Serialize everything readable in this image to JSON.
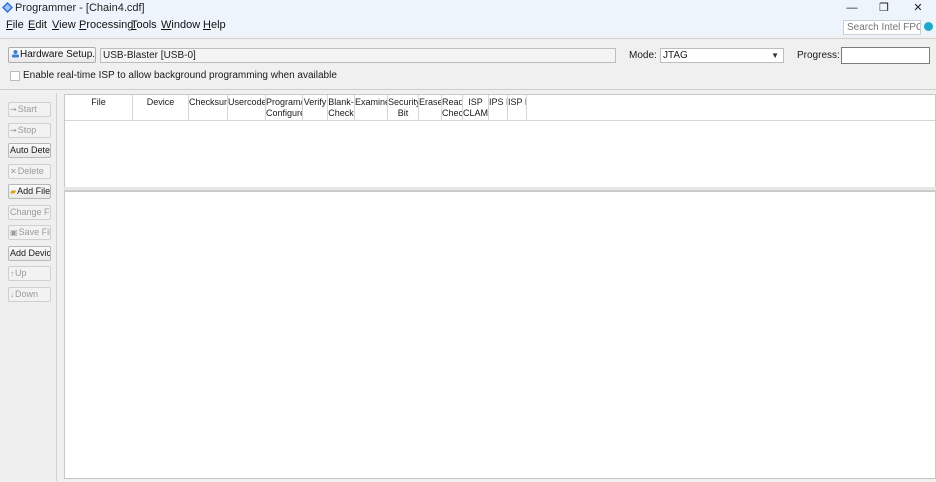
{
  "window": {
    "title": "Programmer - [Chain4.cdf]",
    "minimize": "—",
    "restore": "❐",
    "close": "✕"
  },
  "menu": {
    "items": [
      {
        "label": "File",
        "u": "F",
        "rest": "ile"
      },
      {
        "label": "Edit",
        "u": "E",
        "rest": "dit"
      },
      {
        "label": "View",
        "u": "V",
        "rest": "iew"
      },
      {
        "label": "Processing",
        "u": "P",
        "rest": "rocessing"
      },
      {
        "label": "Tools",
        "u": "T",
        "rest": "ools"
      },
      {
        "label": "Window",
        "u": "W",
        "rest": "indow"
      },
      {
        "label": "Help",
        "u": "H",
        "rest": "elp"
      }
    ],
    "search_placeholder": "Search Intel FPGA"
  },
  "hardware": {
    "setup_label": "Hardware Setup...",
    "setup_icon": "hardware-icon",
    "device": "USB-Blaster [USB-0]",
    "mode_label": "Mode:",
    "mode_value": "JTAG",
    "progress_label": "Progress:",
    "isp_label": "Enable real-time ISP to allow background programming when available"
  },
  "toolbar": {
    "start": "Start",
    "stop": "Stop",
    "auto_detect": "Auto Detect",
    "delete": "Delete",
    "add_file": "Add File...",
    "change_file": "Change File",
    "save_file": "Save File",
    "add_device": "Add Device",
    "up": "Up",
    "down": "Down"
  },
  "table": {
    "columns": [
      {
        "line1": "File",
        "line2": ""
      },
      {
        "line1": "Device",
        "line2": ""
      },
      {
        "line1": "Checksum",
        "line2": ""
      },
      {
        "line1": "Usercode",
        "line2": ""
      },
      {
        "line1": "Program/",
        "line2": "Configure"
      },
      {
        "line1": "Verify",
        "line2": ""
      },
      {
        "line1": "Blank-",
        "line2": "Check"
      },
      {
        "line1": "Examine",
        "line2": ""
      },
      {
        "line1": "Security",
        "line2": "Bit"
      },
      {
        "line1": "Erase",
        "line2": ""
      },
      {
        "line1": "Read",
        "line2": "Checks"
      },
      {
        "line1": "ISP",
        "line2": "CLAMP"
      },
      {
        "line1": "IPS File",
        "line2": ""
      },
      {
        "line1": "ISP File",
        "line2": ""
      }
    ]
  },
  "colors": {
    "titlebar": "#eef4fb",
    "search_accent": "#1fa8c9"
  }
}
